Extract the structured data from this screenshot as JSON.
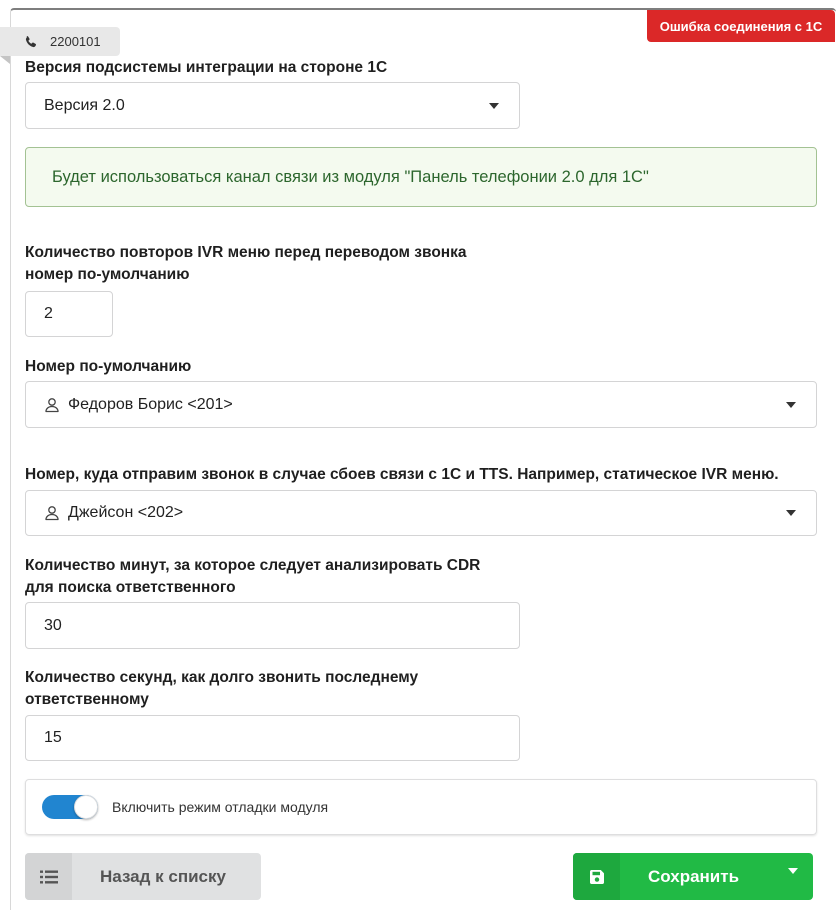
{
  "header": {
    "phone_number": "2200101",
    "status_badge": "Ошибка соединения с 1С"
  },
  "integration_version": {
    "label": "Версия подсистемы интеграции на стороне 1С",
    "value": "Версия 2.0"
  },
  "info_message": "Будет использоваться канал связи из модуля \"Панель телефонии 2.0 для 1С\"",
  "ivr_repeats": {
    "label_line1": "Количество повторов IVR меню перед переводом звонка",
    "label_line2": "номер по-умолчанию",
    "value": "2"
  },
  "default_number": {
    "label": "Номер по-умолчанию",
    "value": "Федоров Борис <201>"
  },
  "fallback_number": {
    "label": "Номер, куда отправим звонок в случае сбоев связи с 1С и TTS. Например, статическое IVR меню.",
    "value": "Джейсон <202>"
  },
  "cdr_minutes": {
    "label_line1": "Количество минут, за которое следует анализировать CDR",
    "label_line2": "для поиска ответственного",
    "value": "30"
  },
  "ring_seconds": {
    "label_line1": "Количество секунд, как долго звонить последнему",
    "label_line2": "ответственному",
    "value": "15"
  },
  "debug_toggle": {
    "label": "Включить режим отладки модуля",
    "enabled": true
  },
  "buttons": {
    "back_label": "Назад к списку",
    "save_label": "Сохранить"
  },
  "colors": {
    "error_badge": "#db2828",
    "success_green": "#21ba45",
    "toggle_blue": "#2185d0",
    "info_bg": "#f4faef",
    "info_text": "#2c662d"
  },
  "icons": {
    "phone": "phone-icon",
    "user": "user-icon",
    "list": "list-icon",
    "save": "save-icon"
  }
}
